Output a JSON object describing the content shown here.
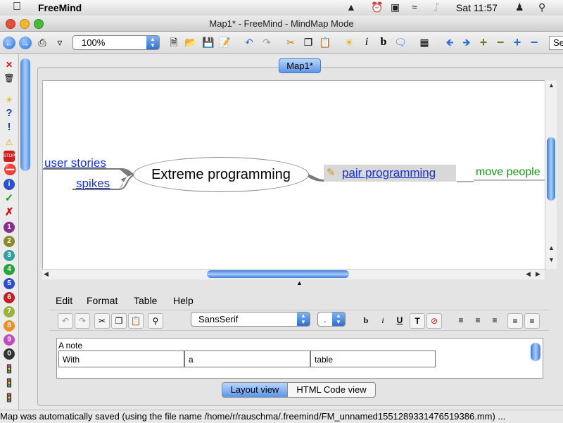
{
  "menubar": {
    "app_name": "FreeMind",
    "clock": "Sat 11:57",
    "icons": [
      "apple-icon",
      "evernote-icon",
      "alarm-icon",
      "display-icon",
      "wifi-icon",
      "bluetooth-icon",
      "user-icon",
      "spotlight-icon"
    ]
  },
  "window": {
    "title": "Map1* - FreeMind - MindMap Mode"
  },
  "toolbar": {
    "zoom": "100%",
    "search_value": "Se"
  },
  "tab": {
    "label": "Map1*"
  },
  "map": {
    "root": "Extreme programming",
    "left_nodes": [
      "user stories",
      "spikes"
    ],
    "right_node": "pair programming",
    "child_node": "move people"
  },
  "note_editor": {
    "menu": [
      "Edit",
      "Format",
      "Table",
      "Help"
    ],
    "font_family": "SansSerif",
    "font_size": ".",
    "note_text": "A note",
    "table_cells": [
      "With",
      "a",
      "table"
    ],
    "views": [
      "Layout view",
      "HTML Code view"
    ]
  },
  "status": {
    "message": "Map was automatically saved (using the file name /home/r/rauschma/.freemind/FM_unnamed1551289331476519386.mm) ..."
  },
  "colors": {
    "link_blue": "#1a32c8",
    "child_green": "#109a10",
    "accent": "#2f6fd0"
  }
}
